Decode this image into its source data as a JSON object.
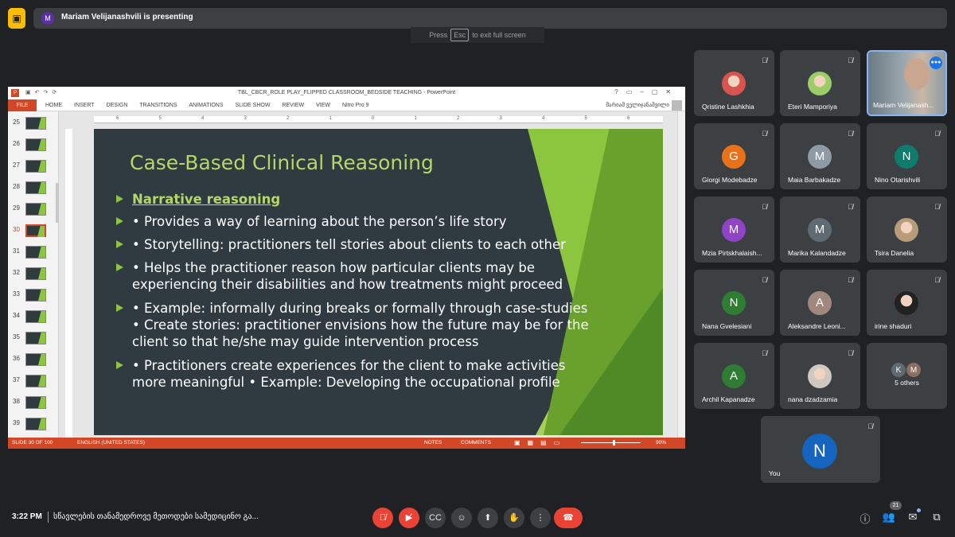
{
  "presenting": {
    "avatar_letter": "M",
    "text": "Mariam Velijanashvili is presenting"
  },
  "esc_hint": {
    "press": "Press",
    "key": "Esc",
    "rest": "to exit full screen"
  },
  "ppt": {
    "title": "TBL_CBCR_ROLE PLAY_FLIPPED CLASSROOM_BEDSIDE TEACHING - PowerPoint",
    "ribbon_file": "FILE",
    "ribbon_tabs": [
      "HOME",
      "INSERT",
      "DESIGN",
      "TRANSITIONS",
      "ANIMATIONS",
      "SLIDE SHOW",
      "REVIEW",
      "VIEW",
      "Nitro Pro 9"
    ],
    "user": "მარიამ ველიჯანაშვილი",
    "thumbnails": [
      "25",
      "26",
      "27",
      "28",
      "29",
      "30",
      "31",
      "32",
      "33",
      "34",
      "35",
      "36",
      "37",
      "38",
      "39"
    ],
    "active_slide": "30",
    "slide": {
      "title": "Case-Based Clinical Reasoning",
      "bullets": [
        "Narrative reasoning",
        "• Provides a way of learning about the person’s life story",
        "• Storytelling: practitioners tell stories about clients to each other",
        "• Helps the practitioner reason how particular clients may be experiencing their disabilities and how treatments might proceed",
        "• Example: informally during breaks or formally through case-studies • Create stories: practitioner envisions how the future may be for the client so that he/she may guide intervention process",
        "• Practitioners create experiences for the client to make activities more meaningful • Example: Developing the occupational profile"
      ]
    },
    "status": {
      "slide": "SLIDE 30 OF 100",
      "language": "ENGLISH (UNITED STATES)",
      "notes": "NOTES",
      "comments": "COMMENTS",
      "zoom": "90%"
    }
  },
  "participants": [
    {
      "name": "Qristine Lashkhia",
      "type": "photo",
      "color": "#d9534f"
    },
    {
      "name": "Eteri Mamporiya",
      "type": "photo",
      "color": "#9ccc65"
    },
    {
      "name": "Mariam Velijanash...",
      "type": "presenter"
    },
    {
      "name": "Giorgi Modebadze",
      "letter": "G",
      "color": "#e8711a"
    },
    {
      "name": "Maia Barbakadze",
      "letter": "M",
      "color": "#8e9ba5"
    },
    {
      "name": "Nino Otarishvili",
      "letter": "N",
      "color": "#0f7b6c"
    },
    {
      "name": "Mzia Pirtskhalaish...",
      "letter": "M",
      "color": "#8e44c4"
    },
    {
      "name": "Marika Kalandadze",
      "letter": "M",
      "color": "#5f6b73"
    },
    {
      "name": "Tsira Danelia",
      "type": "photo",
      "color": "#b89c7a"
    },
    {
      "name": "Nana Gvelesiani",
      "letter": "N",
      "color": "#2e7d32"
    },
    {
      "name": "Aleksandre Leoni...",
      "letter": "A",
      "color": "#a1887f"
    },
    {
      "name": "irine shaduri",
      "type": "photo",
      "color": "#222222"
    },
    {
      "name": "Archil Kapanadze",
      "letter": "A",
      "color": "#2e7d32"
    },
    {
      "name": "nana dzadzamia",
      "type": "photo",
      "color": "#cfc8c0"
    },
    {
      "name": "5 others",
      "type": "others",
      "letters": [
        "K",
        "M"
      ],
      "colors": [
        "#5f6b73",
        "#8d6e63"
      ]
    }
  ],
  "you": {
    "name": "You",
    "letter": "N",
    "color": "#1565c0"
  },
  "bottom": {
    "time": "3:22 PM",
    "meeting": "სწავლების თანამედროვე მეთოდები სამედიცინო გა...",
    "people_count": "21"
  },
  "colors": {
    "accent": "#8ab4f8",
    "danger": "#ea4335",
    "ppt": "#d24726"
  }
}
